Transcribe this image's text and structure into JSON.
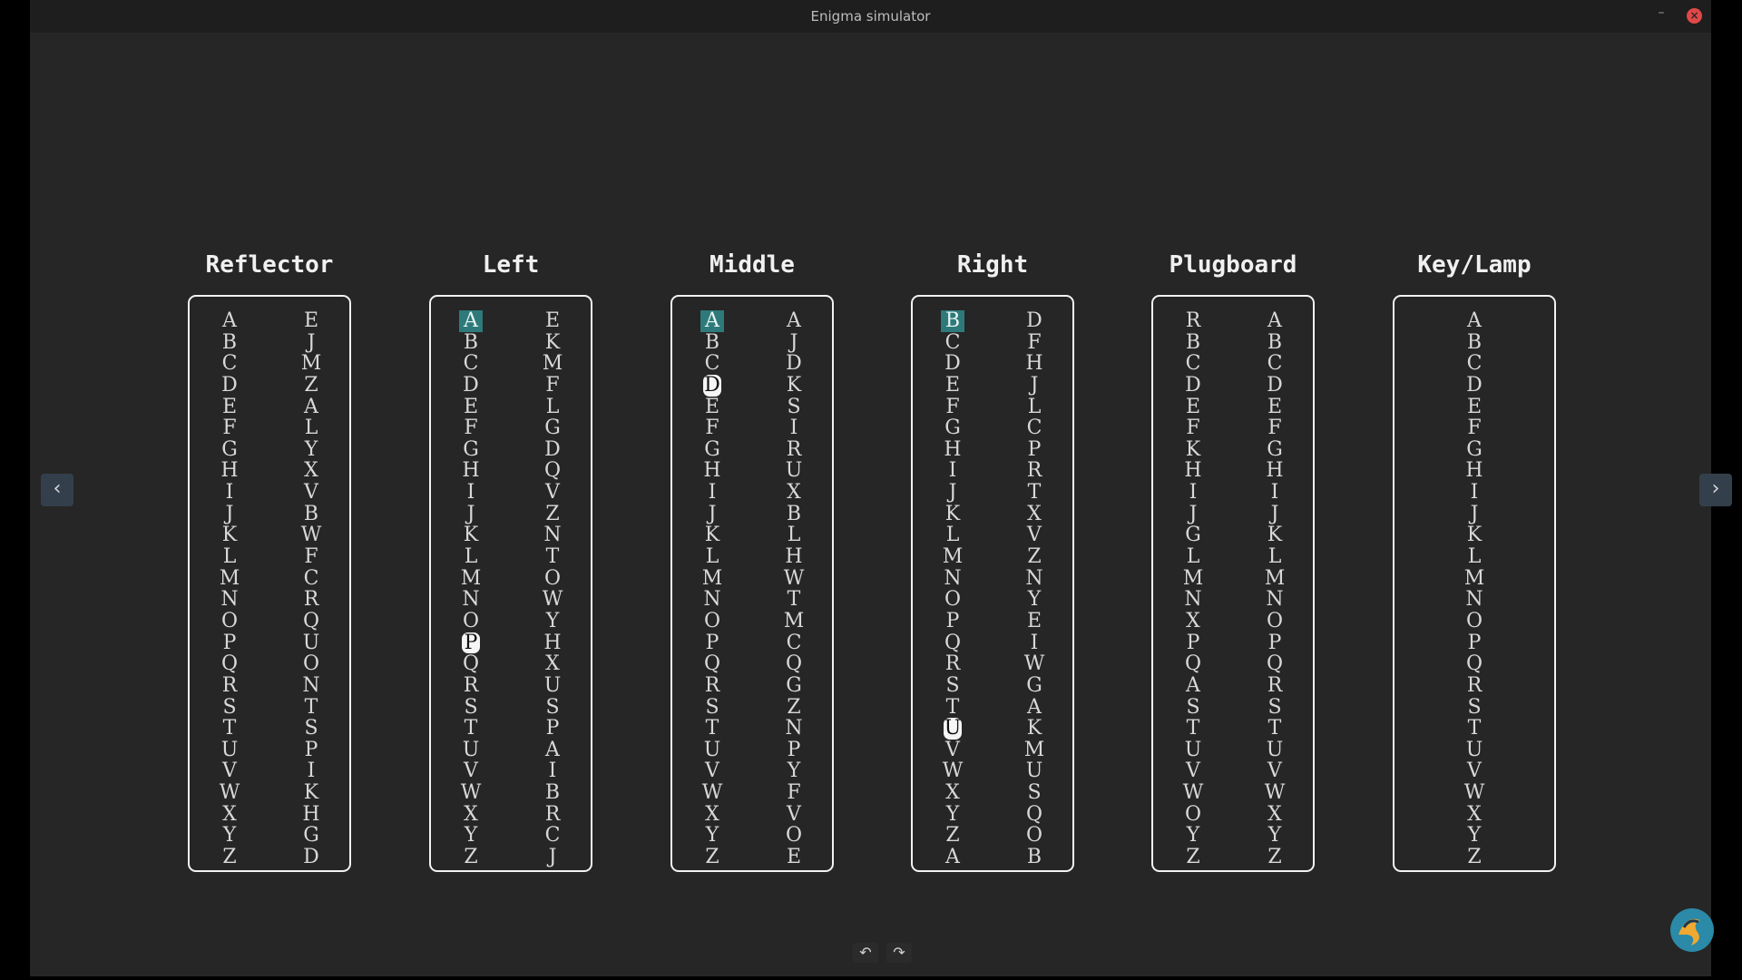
{
  "window": {
    "title": "Enigma simulator",
    "minimize_glyph": "–",
    "close_glyph": "×"
  },
  "nav": {
    "prev_glyph": "‹",
    "next_glyph": "›"
  },
  "toolbar": {
    "rotate_left_glyph": "↶",
    "rotate_right_glyph": "↷"
  },
  "panels": [
    {
      "title": "Reflector",
      "left": "ABCDEFGHIJKLMNOPQRSTUVWXYZ",
      "right": "EJMZALYXVBWFCRQUONTSPIKHGD"
    },
    {
      "title": "Left",
      "left": "ABCDEFGHIJKLMNOPQRSTUVWXYZ",
      "right": "EKMFLGDQVZNTOWYHXUSPAIBRCJ",
      "position_index": 0,
      "active_index": 15
    },
    {
      "title": "Middle",
      "left": "ABCDEFGHIJKLMNOPQRSTUVWXYZ",
      "right": "AJDKSIRUXBLHWTMCQGZNPYFVOE",
      "position_index": 0,
      "active_index": 3
    },
    {
      "title": "Right",
      "left": "BCDEFGHIJKLMNOPQRSTUVWXYZA",
      "right": "DFHJLCPRTXVZNYEIWGAKMUSQOB",
      "position_index": 0,
      "active_index": 19
    },
    {
      "title": "Plugboard",
      "left": "RBCDEFKHIJGLMNXPQASTUVWOYZ",
      "right": "ABCDEFGHIJKLMNOPQRSTUVWXYZ"
    },
    {
      "title": "Key/Lamp",
      "single": "ABCDEFGHIJKLMNOPQRSTUVWXYZ"
    }
  ],
  "colors": {
    "background": "#262626",
    "position_highlight": "#2e7a7a",
    "active_highlight": "#f5f5f5",
    "close_button": "#e04848"
  },
  "icons": [
    "minimize-icon",
    "close-icon",
    "chevron-left-icon",
    "chevron-right-icon",
    "rotate-left-icon",
    "rotate-right-icon",
    "app-logo-icon"
  ]
}
